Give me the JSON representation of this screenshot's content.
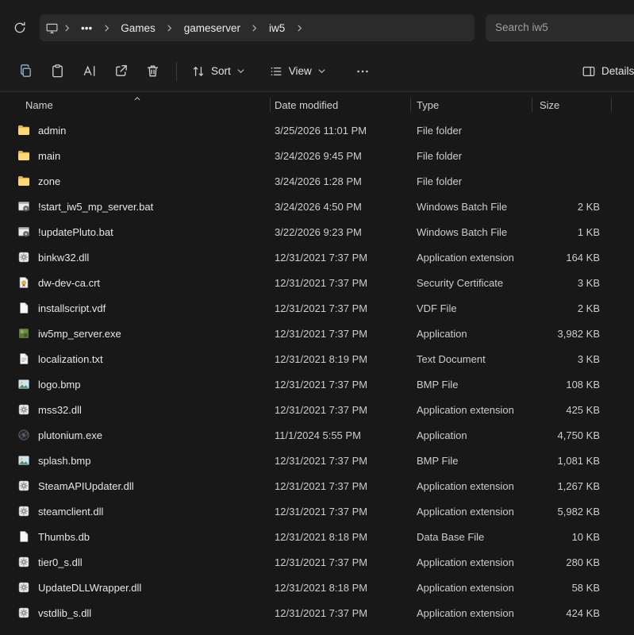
{
  "breadcrumb": {
    "root_icon": "this-pc-icon",
    "overflow_glyph": "•••",
    "items": [
      "Games",
      "gameserver",
      "iw5"
    ]
  },
  "search": {
    "placeholder": "Search iw5"
  },
  "toolbar": {
    "sort_label": "Sort",
    "view_label": "View",
    "details_label": "Details",
    "icon_buttons": [
      "copy-icon",
      "paste-icon",
      "rename-icon",
      "share-icon",
      "delete-icon"
    ]
  },
  "columns": {
    "name": "Name",
    "date": "Date modified",
    "type": "Type",
    "size": "Size"
  },
  "colors": {
    "window_bg": "#181818",
    "chrome_bg": "#1c1c1c",
    "pill_bg": "#2b2b2b",
    "folder_yellow": "#fcd877"
  },
  "files": [
    {
      "name": "admin",
      "date": "3/25/2026 11:01 PM",
      "type": "File folder",
      "size": "",
      "icon": "folder-icon"
    },
    {
      "name": "main",
      "date": "3/24/2026 9:45 PM",
      "type": "File folder",
      "size": "",
      "icon": "folder-icon"
    },
    {
      "name": "zone",
      "date": "3/24/2026 1:28 PM",
      "type": "File folder",
      "size": "",
      "icon": "folder-icon"
    },
    {
      "name": "!start_iw5_mp_server.bat",
      "date": "3/24/2026 4:50 PM",
      "type": "Windows Batch File",
      "size": "2 KB",
      "icon": "batch-icon"
    },
    {
      "name": "!updatePluto.bat",
      "date": "3/22/2026 9:23 PM",
      "type": "Windows Batch File",
      "size": "1 KB",
      "icon": "batch-icon"
    },
    {
      "name": "binkw32.dll",
      "date": "12/31/2021 7:37 PM",
      "type": "Application extension",
      "size": "164 KB",
      "icon": "dll-icon"
    },
    {
      "name": "dw-dev-ca.crt",
      "date": "12/31/2021 7:37 PM",
      "type": "Security Certificate",
      "size": "3 KB",
      "icon": "certificate-icon"
    },
    {
      "name": "installscript.vdf",
      "date": "12/31/2021 7:37 PM",
      "type": "VDF File",
      "size": "2 KB",
      "icon": "file-icon"
    },
    {
      "name": "iw5mp_server.exe",
      "date": "12/31/2021 7:37 PM",
      "type": "Application",
      "size": "3,982 KB",
      "icon": "exe-icon"
    },
    {
      "name": "localization.txt",
      "date": "12/31/2021 8:19 PM",
      "type": "Text Document",
      "size": "3 KB",
      "icon": "text-icon"
    },
    {
      "name": "logo.bmp",
      "date": "12/31/2021 7:37 PM",
      "type": "BMP File",
      "size": "108 KB",
      "icon": "image-icon"
    },
    {
      "name": "mss32.dll",
      "date": "12/31/2021 7:37 PM",
      "type": "Application extension",
      "size": "425 KB",
      "icon": "dll-icon"
    },
    {
      "name": "plutonium.exe",
      "date": "11/1/2024 5:55 PM",
      "type": "Application",
      "size": "4,750 KB",
      "icon": "plutonium-icon"
    },
    {
      "name": "splash.bmp",
      "date": "12/31/2021 7:37 PM",
      "type": "BMP File",
      "size": "1,081 KB",
      "icon": "image-icon"
    },
    {
      "name": "SteamAPIUpdater.dll",
      "date": "12/31/2021 7:37 PM",
      "type": "Application extension",
      "size": "1,267 KB",
      "icon": "dll-icon"
    },
    {
      "name": "steamclient.dll",
      "date": "12/31/2021 7:37 PM",
      "type": "Application extension",
      "size": "5,982 KB",
      "icon": "dll-icon"
    },
    {
      "name": "Thumbs.db",
      "date": "12/31/2021 8:18 PM",
      "type": "Data Base File",
      "size": "10 KB",
      "icon": "file-icon"
    },
    {
      "name": "tier0_s.dll",
      "date": "12/31/2021 7:37 PM",
      "type": "Application extension",
      "size": "280 KB",
      "icon": "dll-icon"
    },
    {
      "name": "UpdateDLLWrapper.dll",
      "date": "12/31/2021 8:18 PM",
      "type": "Application extension",
      "size": "58 KB",
      "icon": "dll-icon"
    },
    {
      "name": "vstdlib_s.dll",
      "date": "12/31/2021 7:37 PM",
      "type": "Application extension",
      "size": "424 KB",
      "icon": "dll-icon"
    }
  ]
}
